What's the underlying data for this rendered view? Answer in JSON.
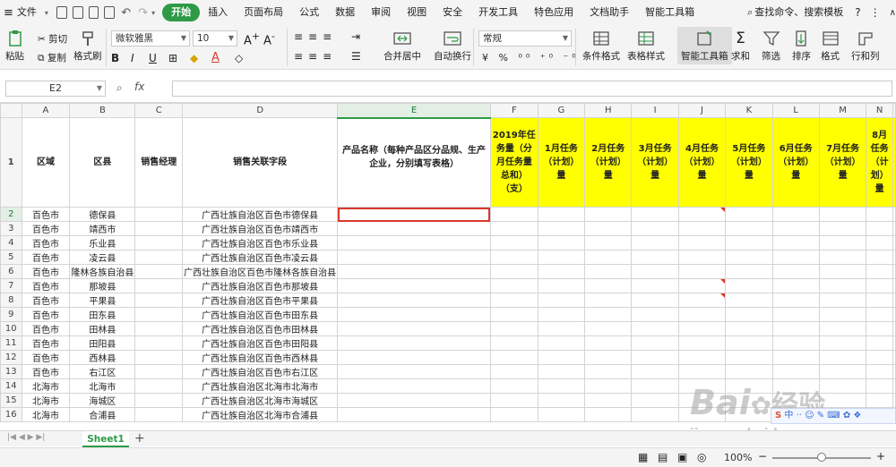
{
  "menubar": {
    "file": "文件",
    "tabs": [
      "开始",
      "插入",
      "页面布局",
      "公式",
      "数据",
      "审阅",
      "视图",
      "安全",
      "开发工具",
      "特色应用",
      "文档助手",
      "智能工具箱"
    ],
    "active_tab": "开始",
    "search": "查找命令、搜索模板"
  },
  "ribbon": {
    "paste": "粘贴",
    "cut": "剪切",
    "copy": "复制",
    "format_painter": "格式刷",
    "font_name": "微软雅黑",
    "font_size": "10",
    "merge_center": "合并居中",
    "wrap_text": "自动换行",
    "number_format": "常规",
    "conditional_format": "条件格式",
    "table_style": "表格样式",
    "smart_toolbox": "智能工具箱",
    "sum": "求和",
    "filter": "筛选",
    "sort": "排序",
    "format": "格式",
    "row_col": "行和列"
  },
  "formula_bar": {
    "name_box": "E2",
    "fx": "fx",
    "value": ""
  },
  "grid": {
    "columns": [
      "A",
      "B",
      "C",
      "D",
      "E",
      "F",
      "G",
      "H",
      "I",
      "J",
      "K",
      "L",
      "M",
      "N"
    ],
    "header_row": {
      "A": "区域",
      "B": "区县",
      "C": "销售经理",
      "D": "销售关联字段",
      "E": "产品名称（每种产品区分品规、生产企业，分别填写表格）",
      "F": "2019年任务量（分月任务量总和）（支）",
      "G": "1月任务（计划）量",
      "H": "2月任务（计划）量",
      "I": "3月任务（计划）量",
      "J": "4月任务（计划）量",
      "K": "5月任务（计划）量",
      "L": "6月任务（计划）量",
      "M": "7月任务（计划）量",
      "N": "8月任务（计划）量"
    },
    "rows": [
      {
        "n": "2",
        "a": "百色市",
        "b": "德保县",
        "d": "广西壮族自治区百色市德保县"
      },
      {
        "n": "3",
        "a": "百色市",
        "b": "靖西市",
        "d": "广西壮族自治区百色市靖西市"
      },
      {
        "n": "4",
        "a": "百色市",
        "b": "乐业县",
        "d": "广西壮族自治区百色市乐业县"
      },
      {
        "n": "5",
        "a": "百色市",
        "b": "凌云县",
        "d": "广西壮族自治区百色市凌云县"
      },
      {
        "n": "6",
        "a": "百色市",
        "b": "隆林各族自治县",
        "d": "广西壮族自治区百色市隆林各族自治县"
      },
      {
        "n": "7",
        "a": "百色市",
        "b": "那坡县",
        "d": "广西壮族自治区百色市那坡县"
      },
      {
        "n": "8",
        "a": "百色市",
        "b": "平果县",
        "d": "广西壮族自治区百色市平果县"
      },
      {
        "n": "9",
        "a": "百色市",
        "b": "田东县",
        "d": "广西壮族自治区百色市田东县"
      },
      {
        "n": "10",
        "a": "百色市",
        "b": "田林县",
        "d": "广西壮族自治区百色市田林县"
      },
      {
        "n": "11",
        "a": "百色市",
        "b": "田阳县",
        "d": "广西壮族自治区百色市田阳县"
      },
      {
        "n": "12",
        "a": "百色市",
        "b": "西林县",
        "d": "广西壮族自治区百色市西林县"
      },
      {
        "n": "13",
        "a": "百色市",
        "b": "右江区",
        "d": "广西壮族自治区百色市右江区"
      },
      {
        "n": "14",
        "a": "北海市",
        "b": "北海市",
        "d": "广西壮族自治区北海市北海市"
      },
      {
        "n": "15",
        "a": "北海市",
        "b": "海城区",
        "d": "广西壮族自治区北海市海城区"
      },
      {
        "n": "16",
        "a": "北海市",
        "b": "合浦县",
        "d": "广西壮族自治区北海市合浦县"
      }
    ]
  },
  "sheet": {
    "tab": "Sheet1",
    "add": "+"
  },
  "status": {
    "zoom": "100%"
  },
  "watermark": {
    "brand": "Bai",
    "brand2": "经验",
    "url": "jingyan.baidu.com"
  },
  "colors": {
    "accent": "#2e9a47",
    "header_fill": "#ffff00",
    "active_border": "#d9382b"
  }
}
